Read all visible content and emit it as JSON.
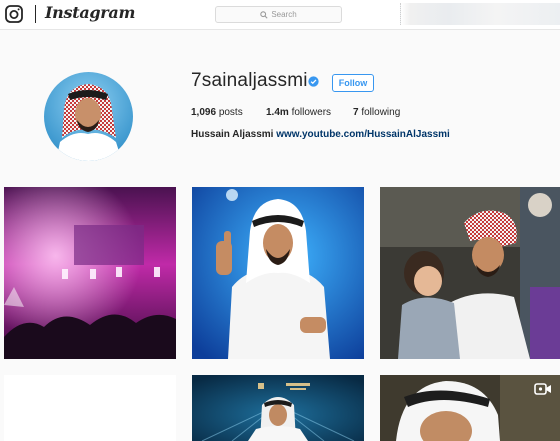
{
  "header": {
    "logo_text": "Instagram",
    "search_placeholder": "Search",
    "icons": [
      "instagram-glyph-icon",
      "search-icon"
    ]
  },
  "profile": {
    "username": "7sainaljassmi",
    "verified": true,
    "follow_label": "Follow",
    "stats": [
      {
        "value": "1,096",
        "label": "posts"
      },
      {
        "value": "1.4m",
        "label": "followers"
      },
      {
        "value": "7",
        "label": "following"
      }
    ],
    "full_name": "Hussain Aljassmi",
    "website": "www.youtube.com/HussainAlJassmi"
  },
  "posts": [
    {
      "kind": "photo",
      "subject": "concert-stage"
    },
    {
      "kind": "photo",
      "subject": "thumbs-up-portrait"
    },
    {
      "kind": "photo",
      "subject": "family-hug"
    },
    {
      "kind": "photo",
      "subject": "blank"
    },
    {
      "kind": "photo",
      "subject": "event-poster"
    },
    {
      "kind": "video",
      "subject": "close-up-portrait"
    }
  ],
  "colors": {
    "accent": "#3897f0",
    "link": "#003569",
    "verified": "#3897f0",
    "background": "#fafafa"
  }
}
